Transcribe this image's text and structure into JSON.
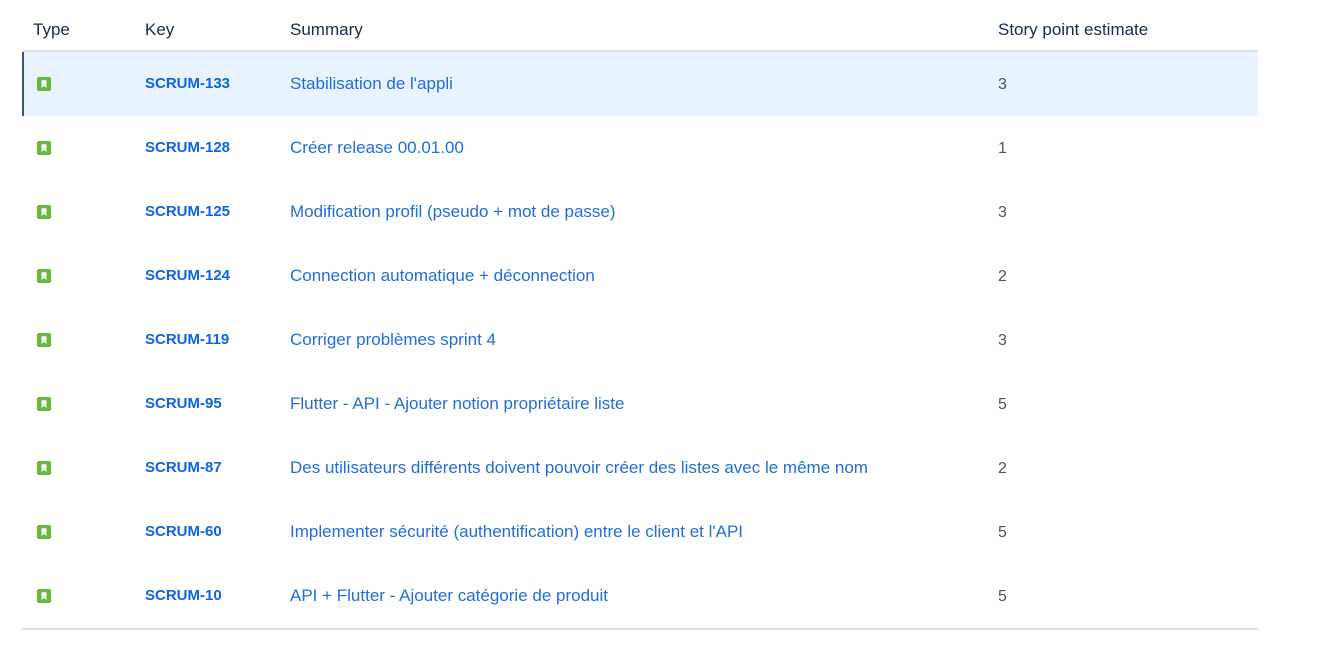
{
  "table": {
    "headers": {
      "type": "Type",
      "key": "Key",
      "summary": "Summary",
      "story_points": "Story point estimate"
    },
    "selected_key": "SCRUM-133",
    "issue_type_icon": "story-bookmark-icon",
    "accent_colors": {
      "story_icon": "#63ba3c",
      "link": "#0c66e4",
      "selected_row": "#e9f2ff"
    },
    "rows": [
      {
        "key": "SCRUM-133",
        "summary": "Stabilisation de l'appli",
        "points": "3"
      },
      {
        "key": "SCRUM-128",
        "summary": "Créer release 00.01.00",
        "points": "1"
      },
      {
        "key": "SCRUM-125",
        "summary": "Modification profil (pseudo + mot de passe)",
        "points": "3"
      },
      {
        "key": "SCRUM-124",
        "summary": "Connection automatique + déconnection",
        "points": "2"
      },
      {
        "key": "SCRUM-119",
        "summary": "Corriger problèmes sprint 4",
        "points": "3"
      },
      {
        "key": "SCRUM-95",
        "summary": "Flutter - API - Ajouter notion propriétaire liste",
        "points": "5"
      },
      {
        "key": "SCRUM-87",
        "summary": "Des utilisateurs différents doivent pouvoir créer des listes avec le même nom",
        "points": "2"
      },
      {
        "key": "SCRUM-60",
        "summary": "Implementer sécurité (authentification) entre le client et l'API",
        "points": "5"
      },
      {
        "key": "SCRUM-10",
        "summary": "API + Flutter - Ajouter catégorie de produit",
        "points": "5"
      }
    ]
  }
}
